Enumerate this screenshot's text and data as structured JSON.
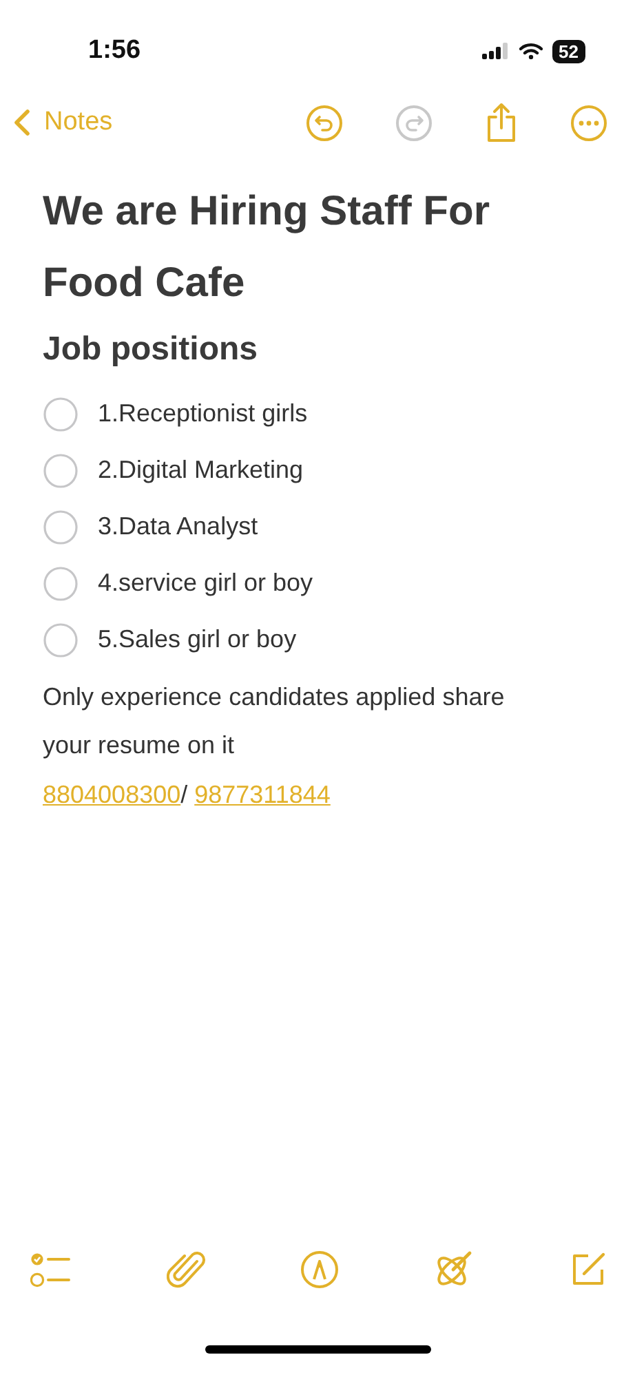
{
  "status_bar": {
    "time": "1:56",
    "battery": "52"
  },
  "nav": {
    "back_label": "Notes",
    "redo_disabled": true
  },
  "note": {
    "title": "We are Hiring Staff For Food Cafe",
    "heading": "Job positions",
    "checklist": [
      {
        "text": "1.Receptionist girls",
        "checked": false
      },
      {
        "text": "2.Digital Marketing",
        "checked": false
      },
      {
        "text": "3.Data Analyst",
        "checked": false
      },
      {
        "text": "4.service girl or boy",
        "checked": false
      },
      {
        "text": "5.Sales girl or boy",
        "checked": false
      }
    ],
    "body": "Only experience candidates applied share your resume on it",
    "phones": [
      "8804008300",
      "9877311844"
    ],
    "separator": "/"
  }
}
